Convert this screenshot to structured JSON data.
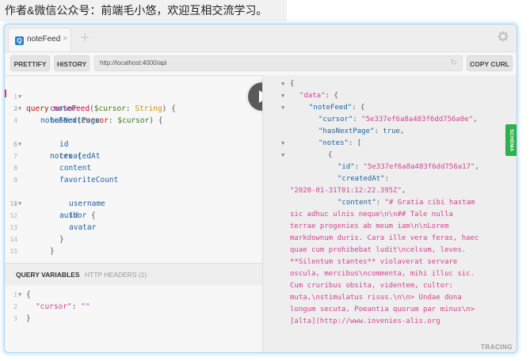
{
  "caption": "作者&微信公众号：前端毛小悠，欢迎互相交流学习。",
  "tab": {
    "badge": "Q",
    "label": "noteFeed",
    "close": "×",
    "add": "+"
  },
  "toolbar": {
    "prettify": "PRETTIFY",
    "history": "HISTORY",
    "url": "http://localhost:4000/api",
    "copy_curl": "COPY CURL"
  },
  "editor": {
    "line_numbers": [
      "1",
      "2",
      "3",
      "4",
      "5",
      "6",
      "7",
      "8",
      "9",
      "10",
      "11",
      "12",
      "13",
      "14",
      "15"
    ],
    "l1": {
      "kw": "query",
      "name": "noteFeed",
      "p1": "(",
      "var": "$cursor",
      "colon": ": ",
      "type": "String",
      "p2": ") {"
    },
    "l2": {
      "field": "noteFeed",
      "p1": "(",
      "arg": "cursor",
      "colon": ": ",
      "var": "$cursor",
      "p2": ") {"
    },
    "l3": "cursor",
    "l4": "hasNextPage",
    "l5": {
      "field": "notes",
      "brace": " {"
    },
    "l6": "id",
    "l7": "createdAt",
    "l8": "content",
    "l9": "favoriteCount",
    "l10": {
      "field": "author",
      "brace": " {"
    },
    "l11": "username",
    "l12": "id",
    "l13": "avatar",
    "l14": "}",
    "l15": "}"
  },
  "vars": {
    "tab_query": "QUERY VARIABLES",
    "tab_headers": "HTTP HEADERS (1)",
    "line_numbers": [
      "1",
      "2",
      "3"
    ],
    "l1": "{",
    "l2_key": "\"cursor\"",
    "l2_colon": ": ",
    "l2_val": "\"\"",
    "l3": "}"
  },
  "result": {
    "r1": "{",
    "r2_key": "\"data\"",
    "r2_rest": ": {",
    "r3_key": "\"noteFeed\"",
    "r3_rest": ": {",
    "r4_key": "\"cursor\"",
    "r4_colon": ": ",
    "r4_val": "\"5e337ef6a8a483f6dd756a0e\"",
    "r4_comma": ",",
    "r5_key": "\"hasNextPage\"",
    "r5_colon": ": ",
    "r5_val": "true",
    "r5_comma": ",",
    "r6_key": "\"notes\"",
    "r6_rest": ": [",
    "r7": "{",
    "r8_key": "\"id\"",
    "r8_colon": ": ",
    "r8_val": "\"5e337ef6a8a483f6dd756a17\"",
    "r8_comma": ",",
    "r9_key": "\"createdAt\"",
    "r9_colon": ":",
    "r10_val": "\"2020-01-31T01:12:22.395Z\"",
    "r10_comma": ",",
    "r11_key": "\"content\"",
    "r11_colon": ": ",
    "r11_val": "\"# Gratia cibi hastam",
    "content_lines": [
      "sic adhuc ulnis neque\\n\\n## Tale nulla",
      "terrae progenies ab meum iam\\n\\nLorem",
      "markdownum duris. Cara ille vera feras, haec",
      "quae cum prohibebat ludit\\ncelsum, leves.",
      "**Silentum stantes** violaverat servare",
      "oscula, mercibus\\ncommenta, mihi illuc sic.",
      "Cum cruribus obsita, videntem, cultor:",
      "muta,\\nstimulatus risus.\\n\\n> Undae dona",
      "longum secuta, Poeantia quorum par minus\\n>",
      "[alta](http://www.invenies-alis.org"
    ]
  },
  "tracing": "TRACING",
  "schema": "SCHEMA"
}
